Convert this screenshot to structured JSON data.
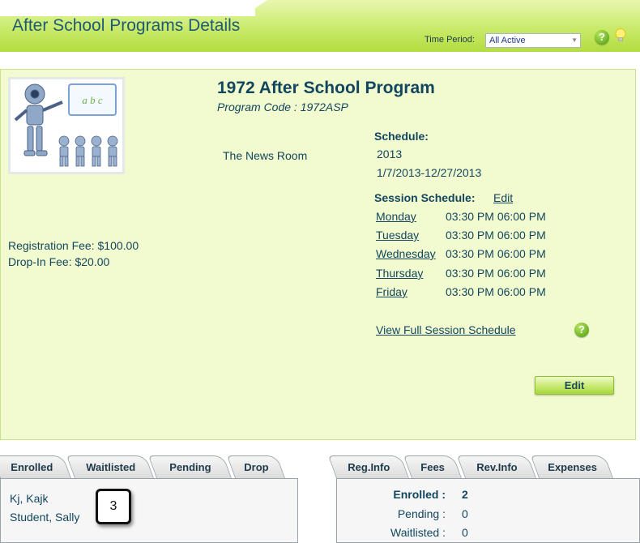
{
  "header": {
    "title": "After School Programs Details",
    "time_period_label": "Time Period:",
    "time_period_value": "All Active"
  },
  "program": {
    "title": "1972 After School Program",
    "code": "Program Code : 1972ASP",
    "location": "The News Room",
    "registration_fee": "Registration Fee: $100.00",
    "dropin_fee": "Drop-In Fee: $20.00",
    "image_letters": "a b c"
  },
  "schedule": {
    "label": "Schedule:",
    "year": "2013",
    "range": "1/7/2013-12/27/2013"
  },
  "session": {
    "label": "Session Schedule:",
    "edit_label": "Edit",
    "days": [
      {
        "day": "Monday",
        "time": "03:30 PM 06:00 PM"
      },
      {
        "day": "Tuesday",
        "time": "03:30 PM 06:00 PM"
      },
      {
        "day": "Wednesday",
        "time": "03:30 PM 06:00 PM"
      },
      {
        "day": "Thursday",
        "time": "03:30 PM 06:00 PM"
      },
      {
        "day": "Friday",
        "time": "03:30 PM 06:00 PM"
      }
    ],
    "full_link": "View Full Session Schedule"
  },
  "edit_button": "Edit",
  "left_tabs": [
    "Enrolled",
    "Waitlisted",
    "Pending",
    "Drop"
  ],
  "enrolled": [
    "Kj, Kajk",
    "Student, Sally"
  ],
  "callout": "3",
  "right_tabs": [
    "Reg.Info",
    "Fees",
    "Rev.Info",
    "Expenses"
  ],
  "reg_info": [
    {
      "label": "Enrolled",
      "sep": ":",
      "value": "2"
    },
    {
      "label": "Pending",
      "sep": ":",
      "value": "0"
    },
    {
      "label": "Waitlisted",
      "sep": ":",
      "value": "0"
    }
  ],
  "colors": {
    "accent": "#b3dc40",
    "panel": "#f2fbcf",
    "text": "#12465e"
  },
  "icons": [
    "help-icon",
    "bulb-icon"
  ]
}
